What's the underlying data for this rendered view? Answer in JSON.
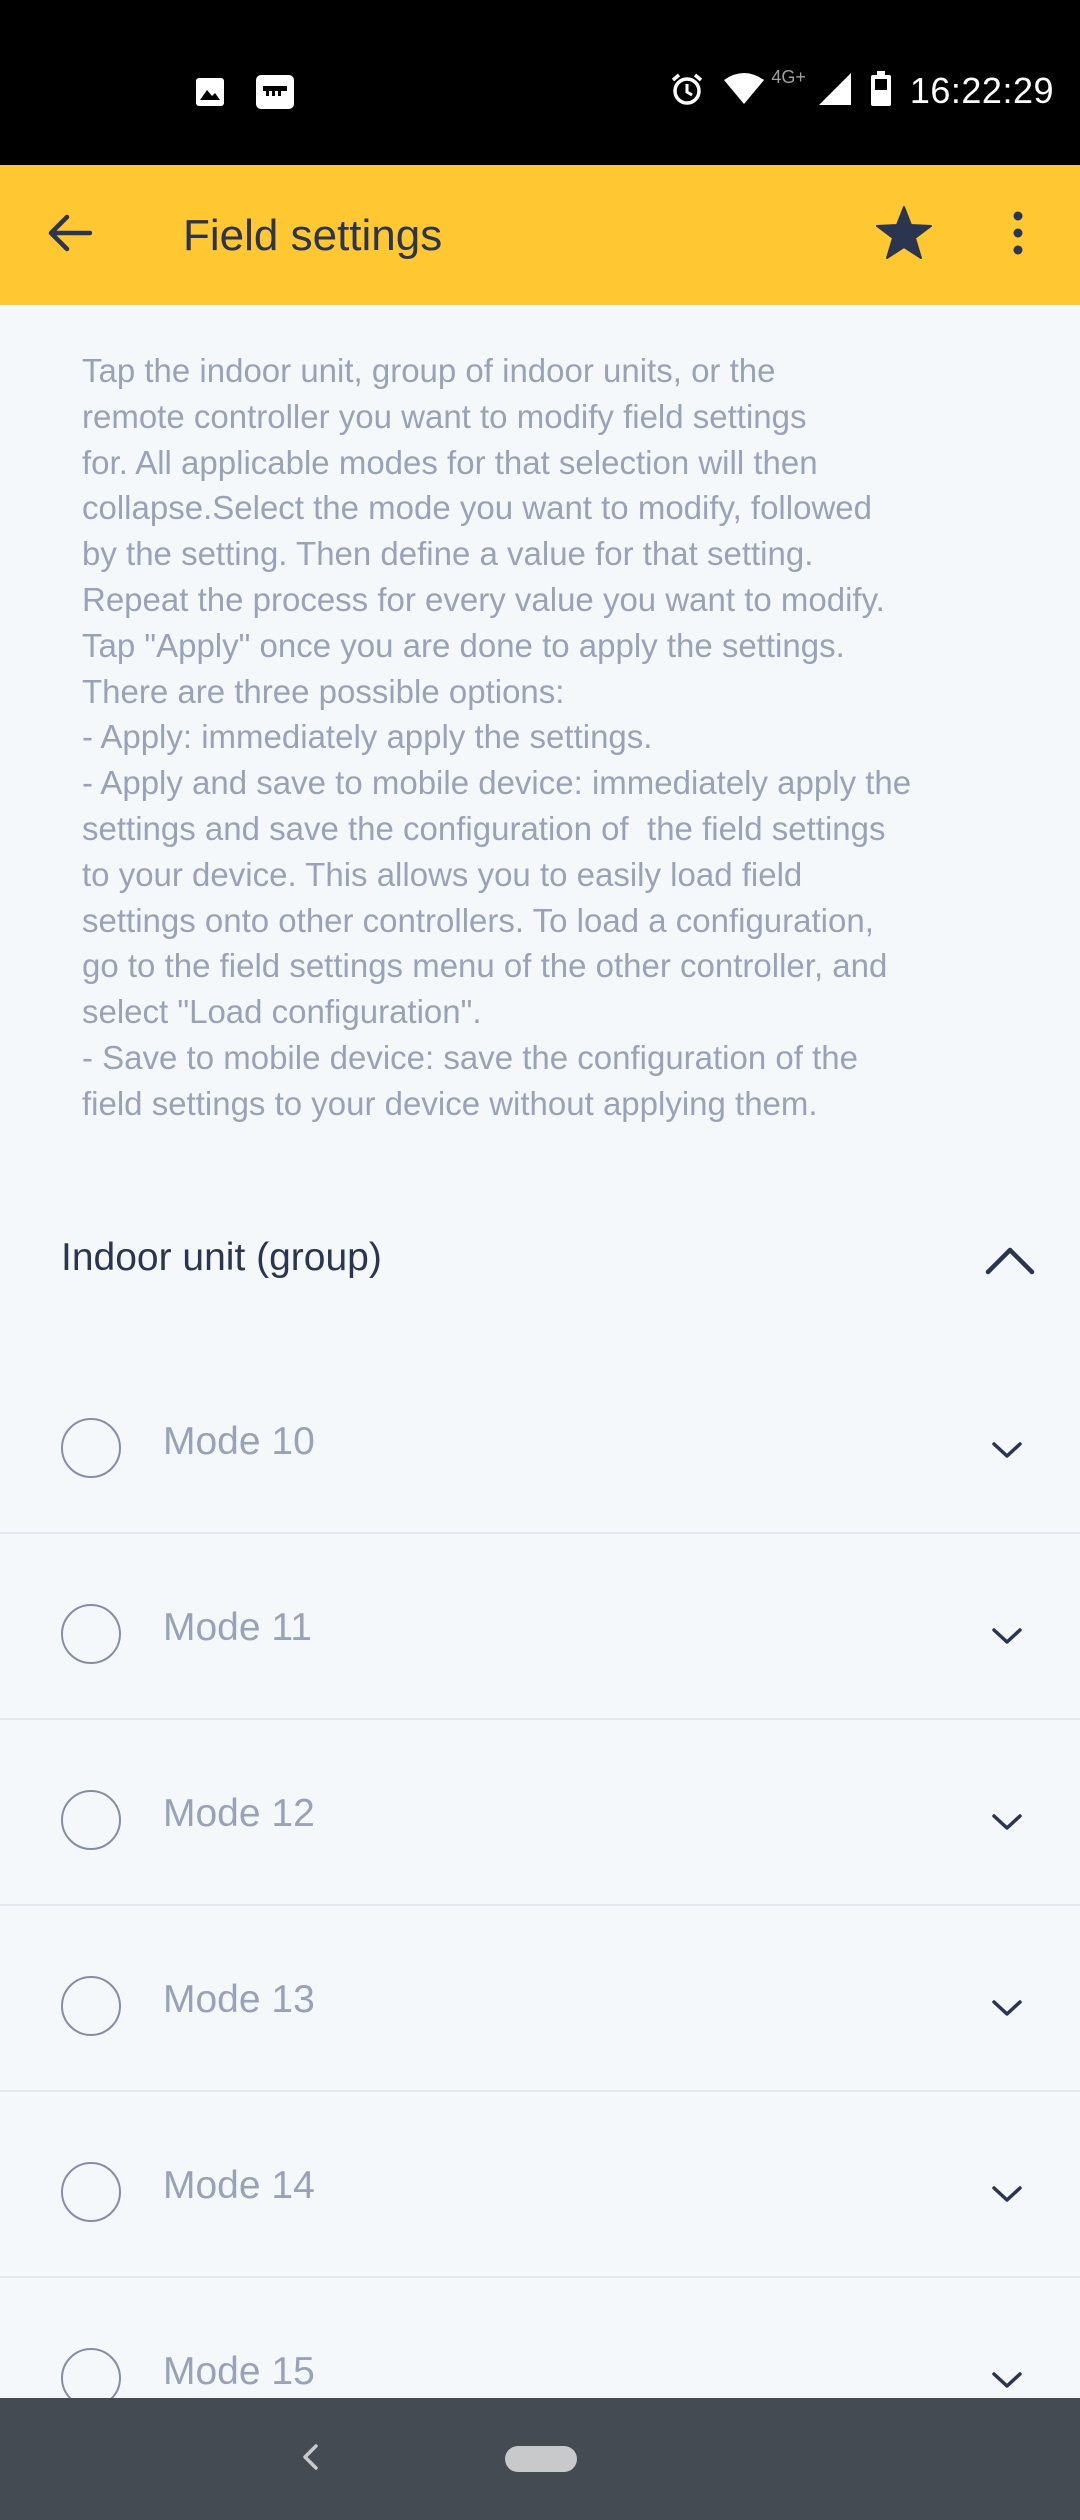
{
  "status_bar": {
    "time": "16:22:29",
    "network_label": "4G+",
    "left_icons": [
      "image-icon",
      "sd-card-icon"
    ],
    "right_icons": [
      "alarm-icon",
      "wifi-icon",
      "signal-icon",
      "battery-icon"
    ]
  },
  "app_bar": {
    "title": "Field settings",
    "back_icon": "arrow-left-icon",
    "favorite_icon": "star-icon",
    "more_icon": "more-vertical-icon",
    "background_color": "#ffc832"
  },
  "instructions": "Tap the indoor unit, group of indoor units, or the\nremote controller you want to modify field settings\nfor. All applicable modes for that selection will then\ncollapse.Select the mode you want to modify, followed\nby the setting. Then define a value for that setting.\nRepeat the process for every value you want to modify.\nTap \"Apply\" once you are done to apply the settings.\nThere are three possible options:\n- Apply: immediately apply the settings.\n- Apply and save to mobile device: immediately apply the\nsettings and save the configuration of  the field settings\nto your device. This allows you to easily load field\nsettings onto other controllers. To load a configuration,\ngo to the field settings menu of the other controller, and\nselect \"Load configuration\".\n- Save to mobile device: save the configuration of the\nfield settings to your device without applying them.",
  "group": {
    "title": "Indoor unit (group)",
    "expanded": true
  },
  "modes": [
    {
      "label": "Mode 10",
      "selected": false
    },
    {
      "label": "Mode 11",
      "selected": false
    },
    {
      "label": "Mode 12",
      "selected": false
    },
    {
      "label": "Mode 13",
      "selected": false
    },
    {
      "label": "Mode 14",
      "selected": false
    },
    {
      "label": "Mode 15",
      "selected": false
    }
  ],
  "colors": {
    "accent": "#ffc832",
    "text_primary": "#2c3550",
    "text_secondary": "#9aa3b6",
    "nav_bar": "#444b52"
  }
}
